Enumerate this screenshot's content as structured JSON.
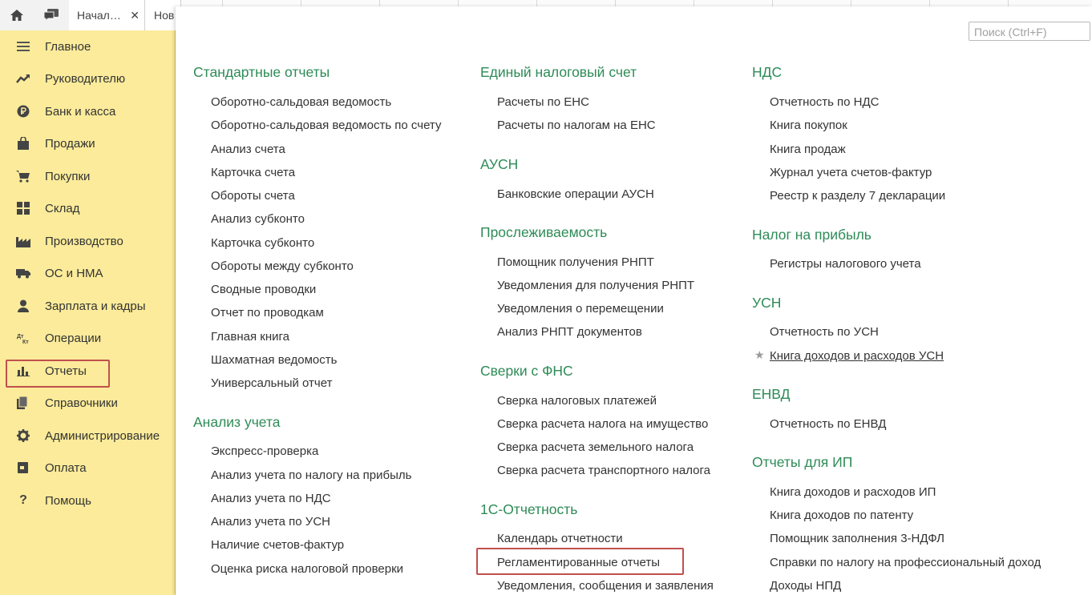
{
  "tabs": {
    "tab1_label": "Начал…",
    "tab1_close": "✕",
    "tab2_label": "Нов"
  },
  "search": {
    "placeholder": "Поиск (Ctrl+F)"
  },
  "sidebar": {
    "items": [
      {
        "label": "Главное",
        "icon": "menu-icon"
      },
      {
        "label": "Руководителю",
        "icon": "trend-icon"
      },
      {
        "label": "Банк и касса",
        "icon": "ruble-coin-icon"
      },
      {
        "label": "Продажи",
        "icon": "shopping-bag-icon"
      },
      {
        "label": "Покупки",
        "icon": "cart-icon"
      },
      {
        "label": "Склад",
        "icon": "warehouse-icon"
      },
      {
        "label": "Производство",
        "icon": "factory-icon"
      },
      {
        "label": "ОС и НМА",
        "icon": "truck-icon"
      },
      {
        "label": "Зарплата и кадры",
        "icon": "person-icon"
      },
      {
        "label": "Операции",
        "icon": "debit-credit-icon"
      },
      {
        "label": "Отчеты",
        "icon": "bar-chart-icon"
      },
      {
        "label": "Справочники",
        "icon": "books-icon"
      },
      {
        "label": "Администрирование",
        "icon": "gear-icon"
      },
      {
        "label": "Оплата",
        "icon": "wallet-icon"
      },
      {
        "label": "Помощь",
        "icon": "question-icon"
      }
    ]
  },
  "columns": {
    "col1": {
      "s1": {
        "title": "Стандартные отчеты",
        "links": [
          "Оборотно-сальдовая ведомость",
          "Оборотно-сальдовая ведомость по счету",
          "Анализ счета",
          "Карточка счета",
          "Обороты счета",
          "Анализ субконто",
          "Карточка субконто",
          "Обороты между субконто",
          "Сводные проводки",
          "Отчет по проводкам",
          "Главная книга",
          "Шахматная ведомость",
          "Универсальный отчет"
        ]
      },
      "s2": {
        "title": "Анализ учета",
        "links": [
          "Экспресс-проверка",
          "Анализ учета по налогу на прибыль",
          "Анализ учета по НДС",
          "Анализ учета по УСН",
          "Наличие счетов-фактур",
          "Оценка риска налоговой проверки"
        ]
      }
    },
    "col2": {
      "s1": {
        "title": "Единый налоговый счет",
        "links": [
          "Расчеты по ЕНС",
          "Расчеты по налогам на ЕНС"
        ]
      },
      "s2": {
        "title": "АУСН",
        "links": [
          "Банковские операции АУСН"
        ]
      },
      "s3": {
        "title": "Прослеживаемость",
        "links": [
          "Помощник получения РНПТ",
          "Уведомления для получения РНПТ",
          "Уведомления о перемещении",
          "Анализ РНПТ документов"
        ]
      },
      "s4": {
        "title": "Сверки с ФНС",
        "links": [
          "Сверка налоговых платежей",
          "Сверка расчета налога на имущество",
          "Сверка расчета земельного налога",
          "Сверка расчета транспортного налога"
        ]
      },
      "s5": {
        "title": "1С-Отчетность",
        "links": [
          "Календарь отчетности",
          "Регламентированные отчеты",
          "Уведомления, сообщения и заявления"
        ]
      }
    },
    "col3": {
      "s1": {
        "title": "НДС",
        "links": [
          "Отчетность по НДС",
          "Книга покупок",
          "Книга продаж",
          "Журнал учета счетов-фактур",
          "Реестр к разделу 7 декларации"
        ]
      },
      "s2": {
        "title": "Налог на прибыль",
        "links": [
          "Регистры налогового учета"
        ]
      },
      "s3": {
        "title": "УСН",
        "links": [
          "Отчетность по УСН",
          "Книга доходов и расходов УСН"
        ]
      },
      "s4": {
        "title": "ЕНВД",
        "links": [
          "Отчетность по ЕНВД"
        ]
      },
      "s5": {
        "title": "Отчеты для ИП",
        "links": [
          "Книга доходов и расходов ИП",
          "Книга доходов по патенту",
          "Помощник заполнения 3-НДФЛ",
          "Справки по налогу на профессиональный доход",
          "Доходы НПД"
        ]
      }
    }
  },
  "colors": {
    "sidebar_bg": "#fbeb9a",
    "section_title": "#2e8b57",
    "highlight": "#c0504d"
  }
}
